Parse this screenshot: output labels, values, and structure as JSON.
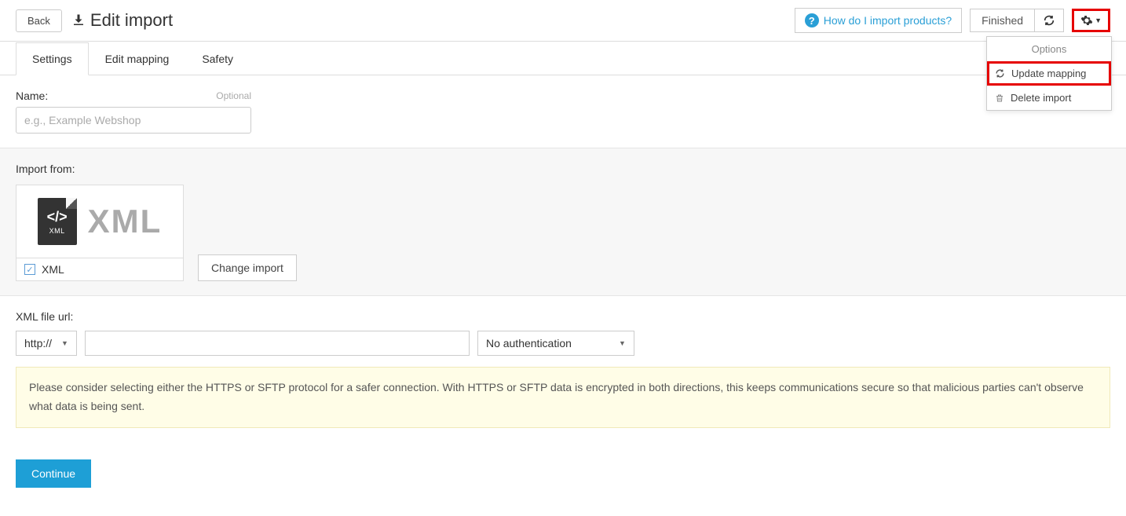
{
  "header": {
    "back": "Back",
    "title": "Edit import",
    "help": "How do I import products?",
    "status": "Finished"
  },
  "dropdown": {
    "header": "Options",
    "update_mapping": "Update mapping",
    "delete_import": "Delete import"
  },
  "tabs": {
    "settings": "Settings",
    "edit_mapping": "Edit mapping",
    "safety": "Safety"
  },
  "name_field": {
    "label": "Name:",
    "optional": "Optional",
    "placeholder": "e.g., Example Webshop",
    "value": ""
  },
  "import_from": {
    "label": "Import from:",
    "type_label": "XML",
    "type_big": "XML",
    "checked_label": "XML",
    "change_button": "Change import"
  },
  "url": {
    "label": "XML file url:",
    "protocol": "http://",
    "value": "",
    "auth": "No authentication"
  },
  "warning": "Please consider selecting either the HTTPS or SFTP protocol for a safer connection. With HTTPS or SFTP data is encrypted in both directions, this keeps communications secure so that malicious parties can't observe what data is being sent.",
  "continue": "Continue"
}
